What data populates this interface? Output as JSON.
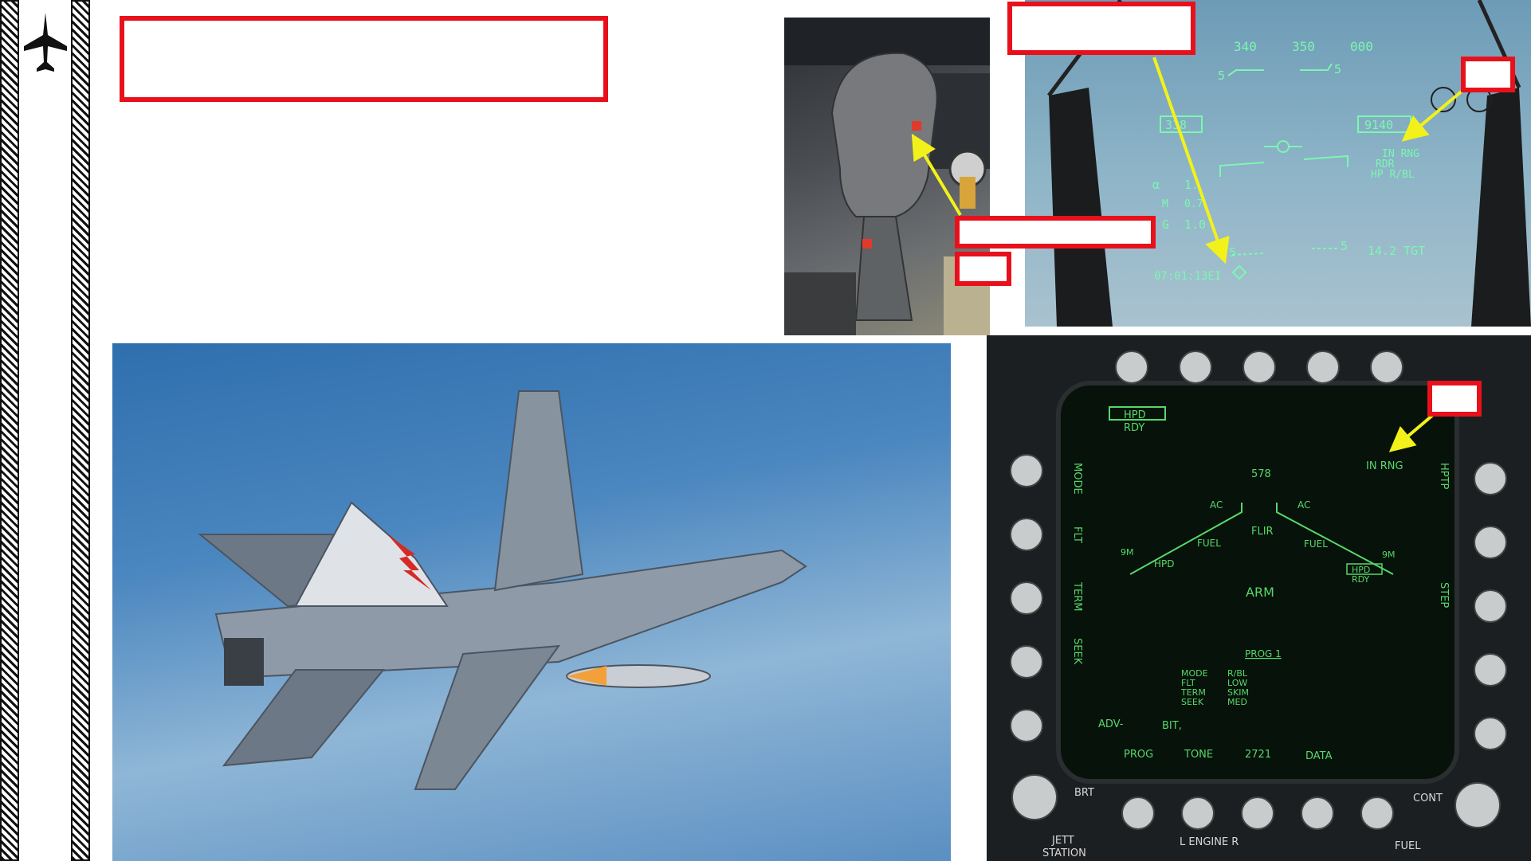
{
  "sidebar": {
    "logo_icon": "fighter-jet-icon"
  },
  "hud": {
    "heading_ticks": [
      "340",
      "350",
      "000"
    ],
    "pitch_left": "5",
    "pitch_right": "5",
    "speed_box": "338",
    "altitude_box": "9140",
    "alpha_label": "α",
    "alpha_value": "1.",
    "mach_label": "M",
    "mach_value": "0.7",
    "g_label": "G",
    "g_value": "1.0",
    "status_lines": [
      "IN RNG",
      "RDR",
      "HP R/BL"
    ],
    "pitch_lower_left": "5",
    "pitch_lower_right": "5",
    "time_to_target": "14.2 TGT",
    "clock": "07:01:13EI"
  },
  "ddi": {
    "top_left_box": "HPD",
    "top_left_sub": "RDY",
    "in_rng": "IN RNG",
    "range_value": "578",
    "left_vertical": [
      "MODE",
      "FLT",
      "TERM",
      "SEEK"
    ],
    "right_vertical": [
      "HPTP",
      "STEP"
    ],
    "left_wing": {
      "ac": "AC",
      "fuel": "FUEL",
      "hpd": "HPD",
      "nine_m": "9M"
    },
    "right_wing": {
      "ac": "AC",
      "fuel": "FUEL",
      "hpd_box": "HPD",
      "rdy": "RDY",
      "nine_m": "9M"
    },
    "center_label": "FLIR",
    "arm_label": "ARM",
    "prog_title": "PROG 1",
    "prog_left": [
      "MODE",
      "FLT",
      "TERM",
      "SEEK"
    ],
    "prog_right": [
      "R/BL",
      "LOW",
      "SKIM",
      "MED"
    ],
    "adv_label": "ADV-",
    "bit_label": "BIT,",
    "bottom_labels": [
      "PROG",
      "TONE",
      "2721",
      "DATA"
    ],
    "brt_label": "BRT",
    "cont_label": "CONT",
    "engine_label": "L  ENGINE  R",
    "jett_label": "JETT",
    "station_label": "STATION",
    "fuel_label": "FUEL"
  },
  "colors": {
    "callout_red": "#e8111b",
    "arrow_yellow": "#f2f21a",
    "hud_green": "#7CF7B0",
    "ddi_green": "#57d86a"
  }
}
